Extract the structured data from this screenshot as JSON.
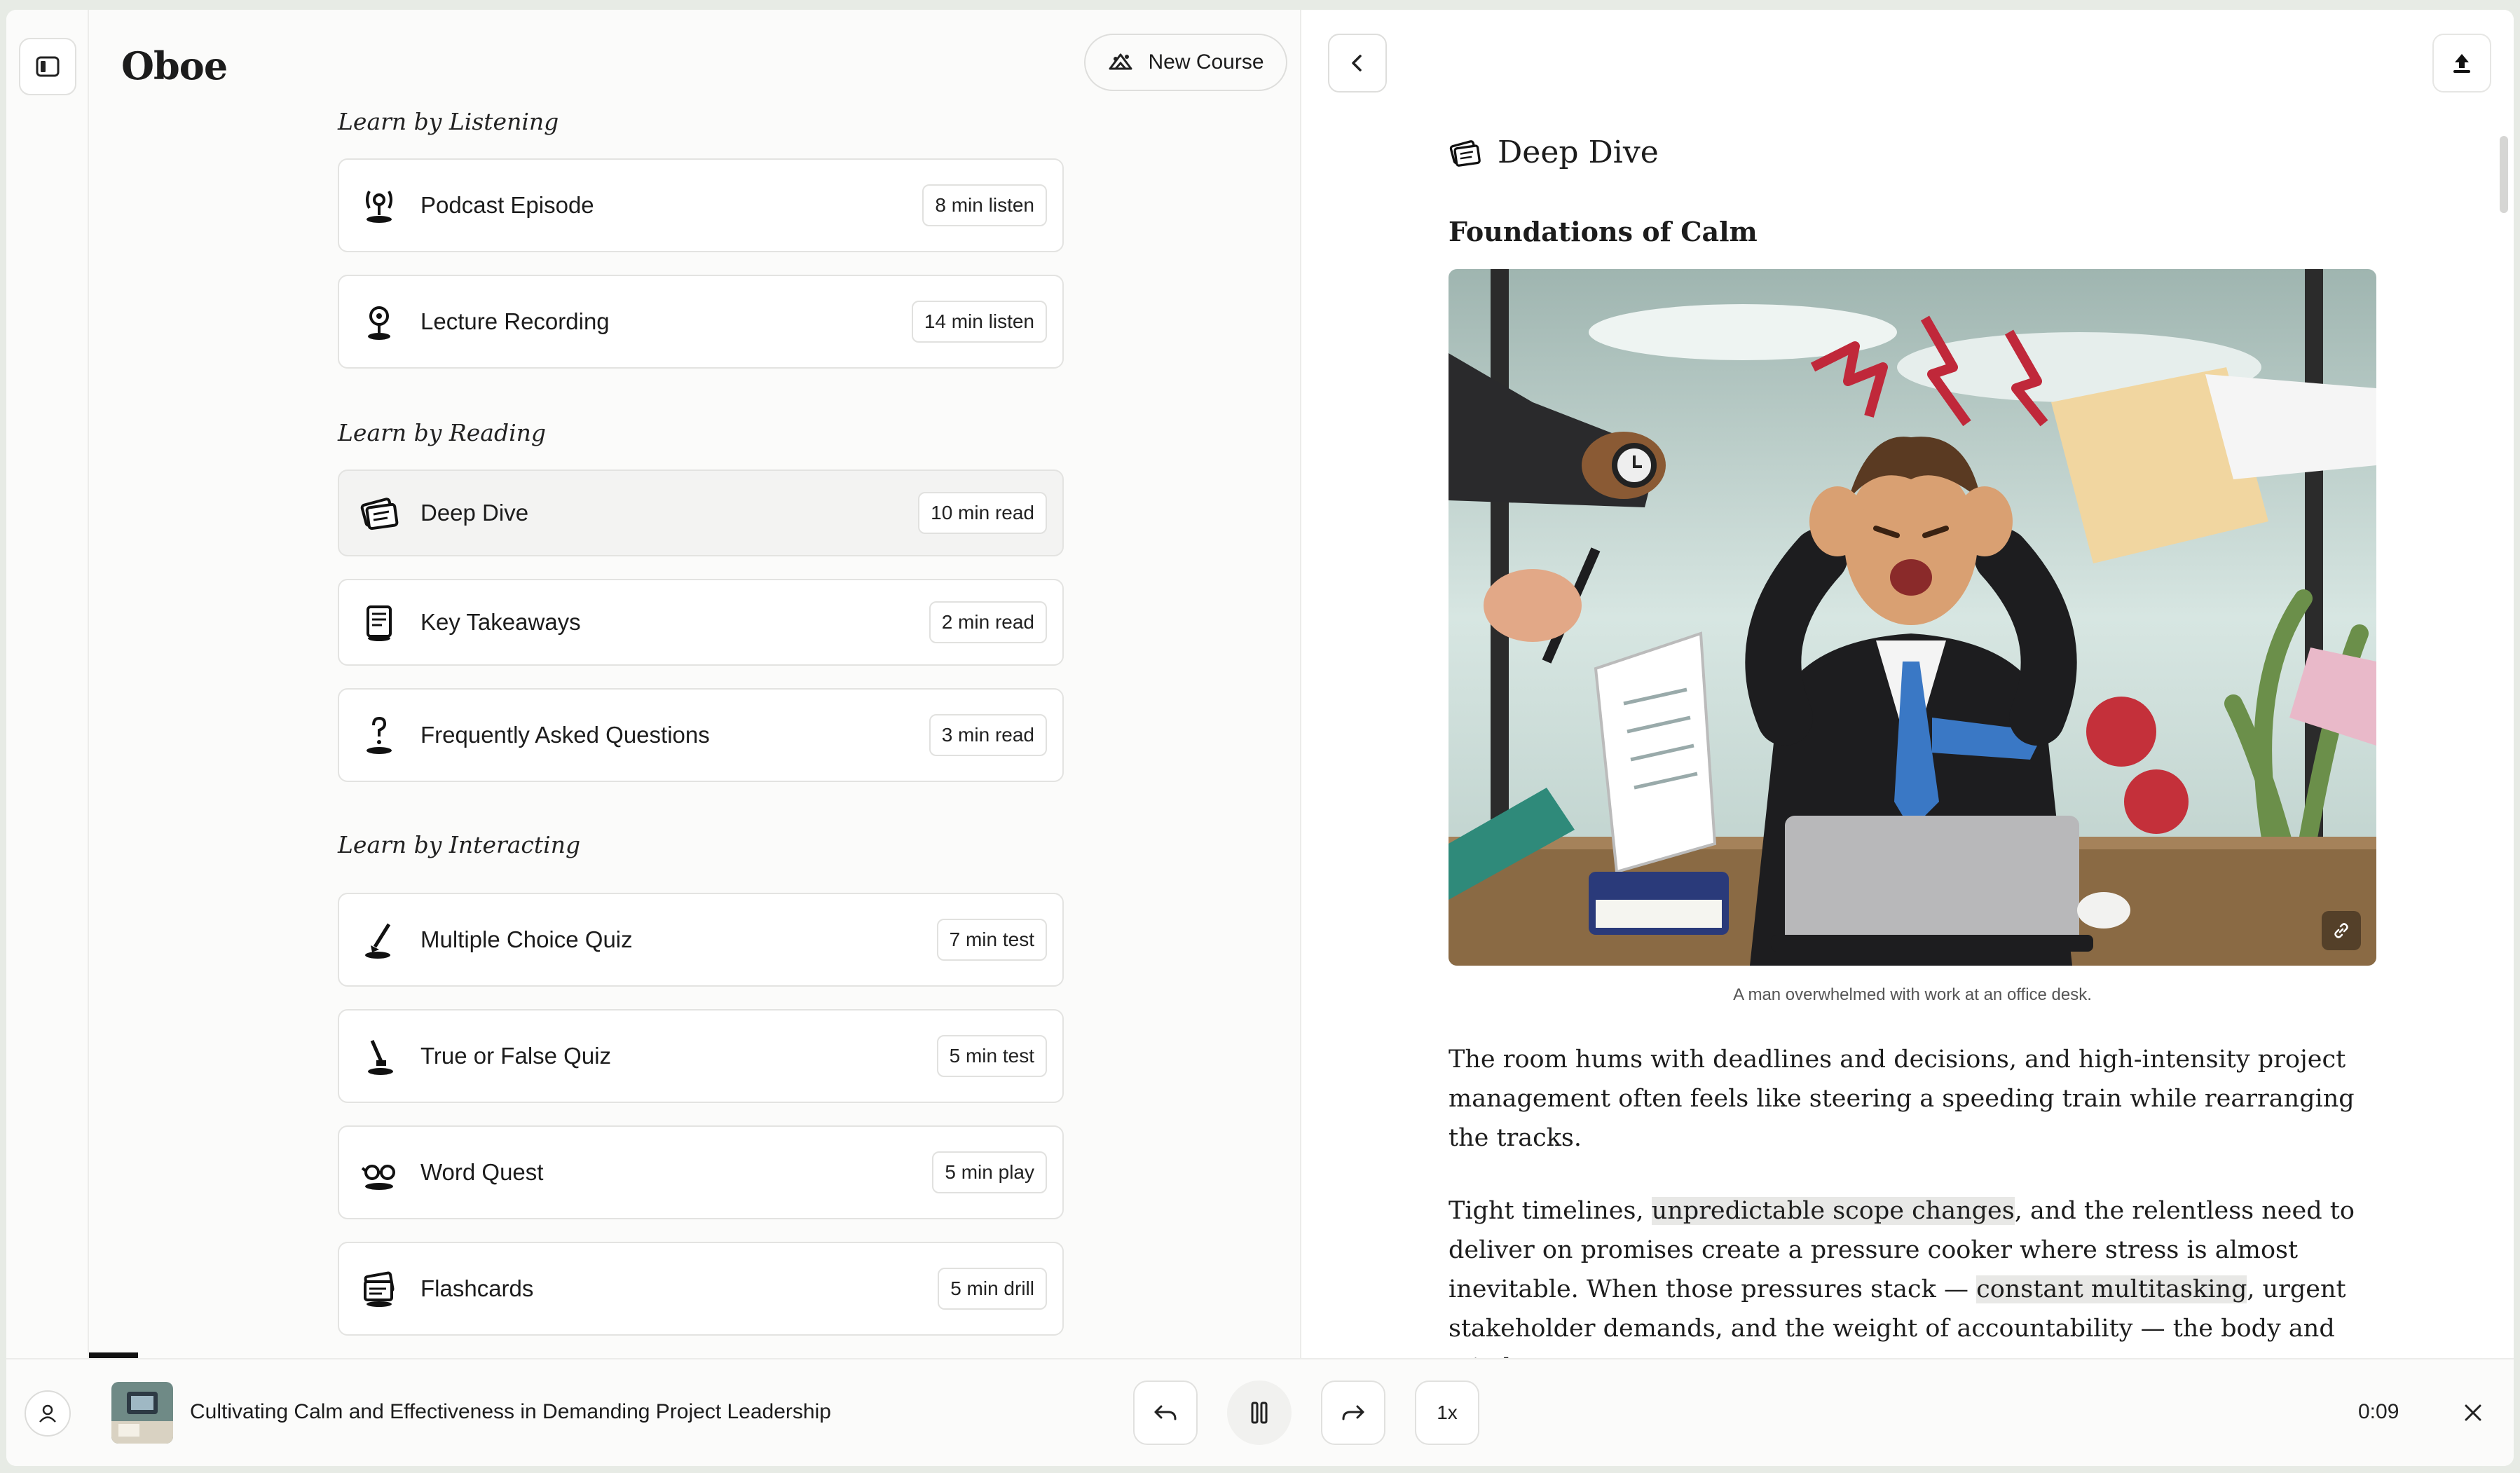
{
  "app": {
    "logo": "Oboe",
    "new_course_label": "New Course"
  },
  "sections": [
    {
      "title": "Learn by Listening"
    },
    {
      "title": "Learn by Reading"
    },
    {
      "title": "Learn by Interacting"
    }
  ],
  "items": [
    {
      "label": "Podcast Episode",
      "badge": "8 min listen",
      "icon": "podcast-icon"
    },
    {
      "label": "Lecture Recording",
      "badge": "14 min listen",
      "icon": "lecture-icon"
    },
    {
      "label": "Deep Dive",
      "badge": "10 min read",
      "icon": "deep-dive-icon",
      "active": true
    },
    {
      "label": "Key Takeaways",
      "badge": "2 min read",
      "icon": "takeaways-icon"
    },
    {
      "label": "Frequently Asked Questions",
      "badge": "3 min read",
      "icon": "faq-icon"
    },
    {
      "label": "Multiple Choice Quiz",
      "badge": "7 min test",
      "icon": "quiz-icon"
    },
    {
      "label": "True or False Quiz",
      "badge": "5 min test",
      "icon": "true-false-icon"
    },
    {
      "label": "Word Quest",
      "badge": "5 min play",
      "icon": "word-quest-icon"
    },
    {
      "label": "Flashcards",
      "badge": "5 min drill",
      "icon": "flashcards-icon"
    }
  ],
  "reader": {
    "title": "Deep Dive",
    "subheading": "Foundations of Calm",
    "image_caption": "A man overwhelmed with work at an office desk.",
    "p1": "The room hums with deadlines and decisions, and high-intensity project management often feels like steering a speeding train while rearranging the tracks.",
    "p2_a": "Tight timelines, ",
    "p2_hl1": "unpredictable scope changes",
    "p2_b": ", and the relentless need to deliver on promises create a pressure cooker where stress is almost inevitable. When those pressures stack — ",
    "p2_hl2": "constant multitasking",
    "p2_c": ", urgent stakeholder demands, and the weight of accountability — the body and mind"
  },
  "player": {
    "track_title": "Cultivating Calm and Effectiveness in Demanding Project Leadership",
    "speed": "1x",
    "time": "0:09"
  }
}
